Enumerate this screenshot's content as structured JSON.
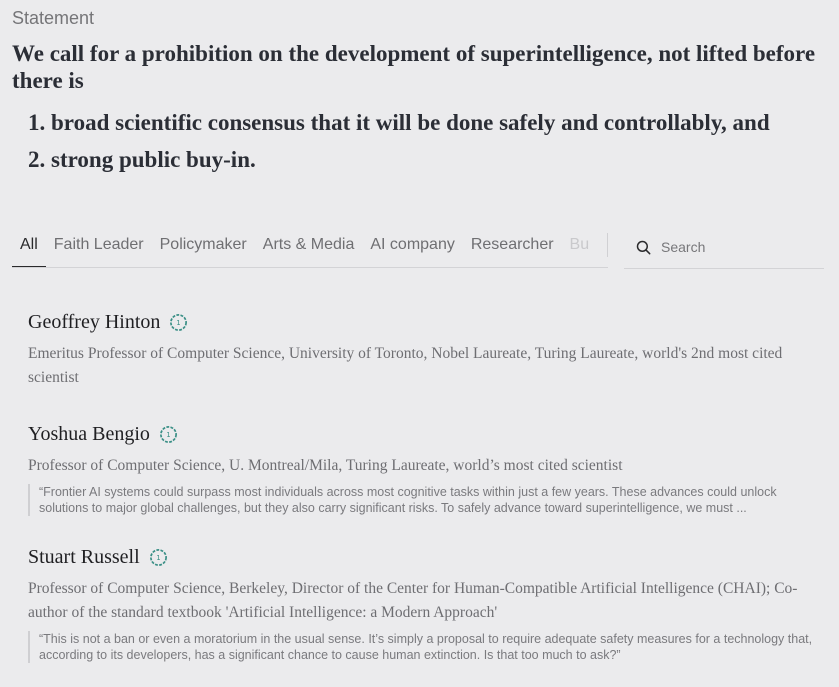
{
  "statement": {
    "label": "Statement",
    "text": "We call for a prohibition on the development of superintelligence, not lifted before there is",
    "conditions": [
      "1. broad scientific consensus that it will be done safely and controllably, and",
      "2. strong public buy-in."
    ]
  },
  "tabs": [
    {
      "label": "All",
      "active": true
    },
    {
      "label": "Faith Leader"
    },
    {
      "label": "Policymaker"
    },
    {
      "label": "Arts & Media"
    },
    {
      "label": "AI company"
    },
    {
      "label": "Researcher"
    },
    {
      "label": "Bu"
    }
  ],
  "search": {
    "placeholder": "Search",
    "icon": "search-icon"
  },
  "signatories": [
    {
      "name": "Geoffrey Hinton",
      "badge_icon": "verified-badge-icon",
      "description": "Emeritus Professor of Computer Science, University of Toronto, Nobel Laureate, Turing Laureate, world's 2nd most cited scientist"
    },
    {
      "name": "Yoshua Bengio",
      "badge_icon": "verified-badge-icon",
      "description": "Professor of Computer Science, U. Montreal/Mila, Turing Laureate, world’s most cited scientist",
      "quote": "“Frontier AI systems could surpass most individuals across most cognitive tasks within just a few years. These advances could unlock solutions to major global challenges, but they also carry significant risks. To safely advance toward superintelligence, we must ..."
    },
    {
      "name": "Stuart Russell",
      "badge_icon": "verified-badge-icon",
      "description": "Professor of Computer Science, Berkeley, Director of the Center for Human-Compatible Artificial Intelligence (CHAI); Co-author of the standard textbook 'Artificial Intelligence: a Modern Approach'",
      "quote": "“This is not a ban or even a moratorium in the usual sense. It’s simply a proposal to require adequate safety measures for a technology that, according to its developers, has a significant chance to cause human extinction. Is that too much to ask?”"
    }
  ],
  "colors": {
    "background": "#ebebed",
    "badge": "#3a8f86",
    "text_dark": "#2b2e36",
    "text_muted": "#6e6e72"
  }
}
